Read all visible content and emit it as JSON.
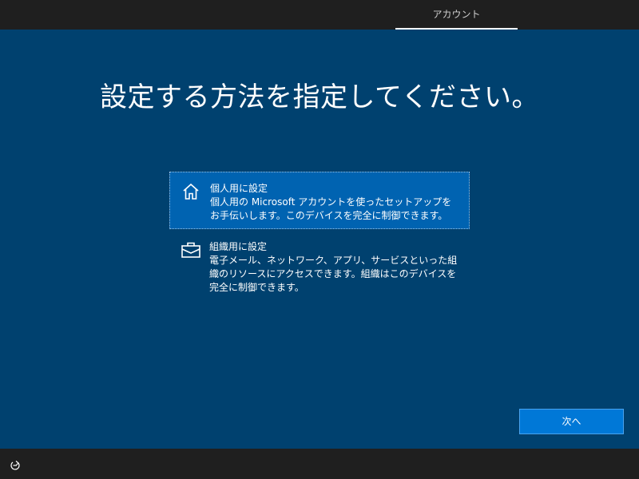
{
  "header": {
    "tab_label": "アカウント"
  },
  "main": {
    "title": "設定する方法を指定してください。",
    "options": [
      {
        "icon": "home-icon",
        "title": "個人用に設定",
        "description": "個人用の Microsoft アカウントを使ったセットアップをお手伝いします。このデバイスを完全に制御できます。",
        "selected": true
      },
      {
        "icon": "briefcase-icon",
        "title": "組織用に設定",
        "description": "電子メール、ネットワーク、アプリ、サービスといった組織のリソースにアクセスできます。組織はこのデバイスを完全に制御できます。",
        "selected": false
      }
    ],
    "next_label": "次へ"
  },
  "footer": {
    "icon": "accessibility-icon"
  },
  "colors": {
    "background": "#00416f",
    "selected": "#0063b1",
    "button": "#0078d7",
    "bar": "#1f1f1f"
  }
}
